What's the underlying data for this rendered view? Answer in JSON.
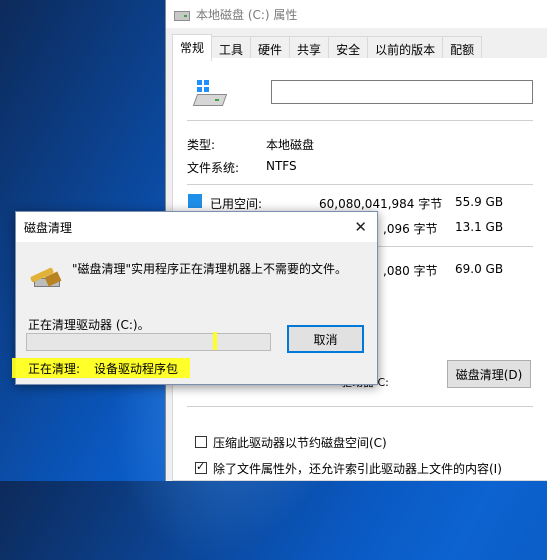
{
  "props_window": {
    "title": "本地磁盘 (C:) 属性",
    "tabs": [
      "常规",
      "工具",
      "硬件",
      "共享",
      "安全",
      "以前的版本",
      "配额"
    ],
    "active_tab": "常规",
    "volume_label_value": "",
    "type_label": "类型:",
    "type_value": "本地磁盘",
    "fs_label": "文件系统:",
    "fs_value": "NTFS",
    "used_label": "已用空间:",
    "used_bytes": "60,080,041,984 字节",
    "used_gb": "55.9 GB",
    "free_bytes_partial": ",096 字节",
    "free_gb": "13.1 GB",
    "capacity_bytes_partial": ",080 字节",
    "capacity_gb": "69.0 GB",
    "drive_label_partial": "驱动器 C:",
    "cleanup_button": "磁盘清理(D)",
    "compress_label": "压缩此驱动器以节约磁盘空间(C)",
    "index_label": "除了文件属性外，还允许索引此驱动器上文件的内容(I)",
    "compress_checked": false,
    "index_checked": true,
    "used_color": "#1e8fe8",
    "free_color": "#c8c8c8"
  },
  "cleanup_dialog": {
    "title": "磁盘清理",
    "message": "\"磁盘清理\"实用程序正在清理机器上不需要的文件。",
    "drive_status": "正在清理驱动器 (C:)。",
    "progress": 0,
    "cancel_button": "取消",
    "current_prefix": "正在清理:",
    "current_item": "设备驱动程序包",
    "highlight_color": "#ffff1f"
  }
}
